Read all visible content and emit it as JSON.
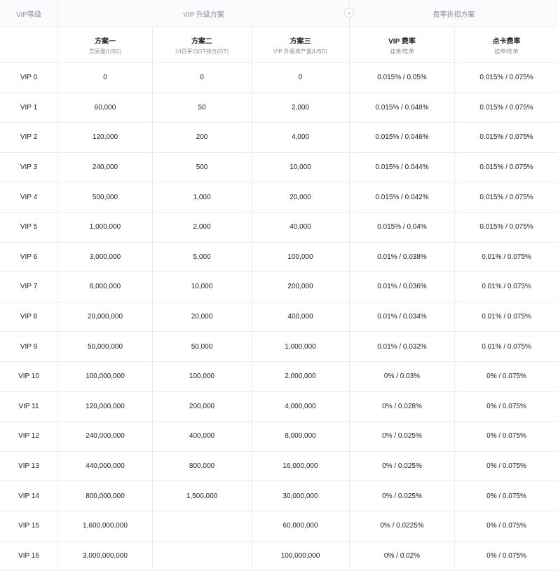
{
  "header": {
    "vip_level": "VIP等级",
    "upgrade_plan": "VIP 升级方案",
    "discount_plan": "费率折扣方案",
    "nav_icon": "chevron-left-icon"
  },
  "subheader": [
    {
      "title": "",
      "sub": ""
    },
    {
      "title": "方案一",
      "sub": "交易量(USD)"
    },
    {
      "title": "方案二",
      "sub": "14日平均GT持仓(GT)"
    },
    {
      "title": "方案三",
      "sub": "VIP 升级资产量(USD)"
    },
    {
      "title": "VIP 费率",
      "sub": "挂单/吃单"
    },
    {
      "title": "点卡费率",
      "sub": "挂单/吃单"
    }
  ],
  "rows": [
    [
      "VIP 0",
      "0",
      "0",
      "0",
      "0.015% / 0.05%",
      "0.015% / 0.075%"
    ],
    [
      "VIP 1",
      "60,000",
      "50",
      "2,000",
      "0.015% / 0.048%",
      "0.015% / 0.075%"
    ],
    [
      "VIP 2",
      "120,000",
      "200",
      "4,000",
      "0.015% / 0.046%",
      "0.015% / 0.075%"
    ],
    [
      "VIP 3",
      "240,000",
      "500",
      "10,000",
      "0.015% / 0.044%",
      "0.015% / 0.075%"
    ],
    [
      "VIP 4",
      "500,000",
      "1,000",
      "20,000",
      "0.015% / 0.042%",
      "0.015% / 0.075%"
    ],
    [
      "VIP 5",
      "1,000,000",
      "2,000",
      "40,000",
      "0.015% / 0.04%",
      "0.015% / 0.075%"
    ],
    [
      "VIP 6",
      "3,000,000",
      "5,000",
      "100,000",
      "0.01% / 0.038%",
      "0.01% / 0.075%"
    ],
    [
      "VIP 7",
      "8,000,000",
      "10,000",
      "200,000",
      "0.01% / 0.036%",
      "0.01% / 0.075%"
    ],
    [
      "VIP 8",
      "20,000,000",
      "20,000",
      "400,000",
      "0.01% / 0.034%",
      "0.01% / 0.075%"
    ],
    [
      "VIP 9",
      "50,000,000",
      "50,000",
      "1,000,000",
      "0.01% / 0.032%",
      "0.01% / 0.075%"
    ],
    [
      "VIP 10",
      "100,000,000",
      "100,000",
      "2,000,000",
      "0% / 0.03%",
      "0% / 0.075%"
    ],
    [
      "VIP 11",
      "120,000,000",
      "200,000",
      "4,000,000",
      "0% / 0.028%",
      "0% / 0.075%"
    ],
    [
      "VIP 12",
      "240,000,000",
      "400,000",
      "8,000,000",
      "0% / 0.025%",
      "0% / 0.075%"
    ],
    [
      "VIP 13",
      "440,000,000",
      "800,000",
      "16,000,000",
      "0% / 0.025%",
      "0% / 0.075%"
    ],
    [
      "VIP 14",
      "800,000,000",
      "1,500,000",
      "30,000,000",
      "0% / 0.025%",
      "0% / 0.075%"
    ],
    [
      "VIP 15",
      "1,600,000,000",
      "",
      "60,000,000",
      "0% / 0.0225%",
      "0% / 0.075%"
    ],
    [
      "VIP 16",
      "3,000,000,000",
      "",
      "100,000,000",
      "0% / 0.02%",
      "0% / 0.075%"
    ]
  ]
}
